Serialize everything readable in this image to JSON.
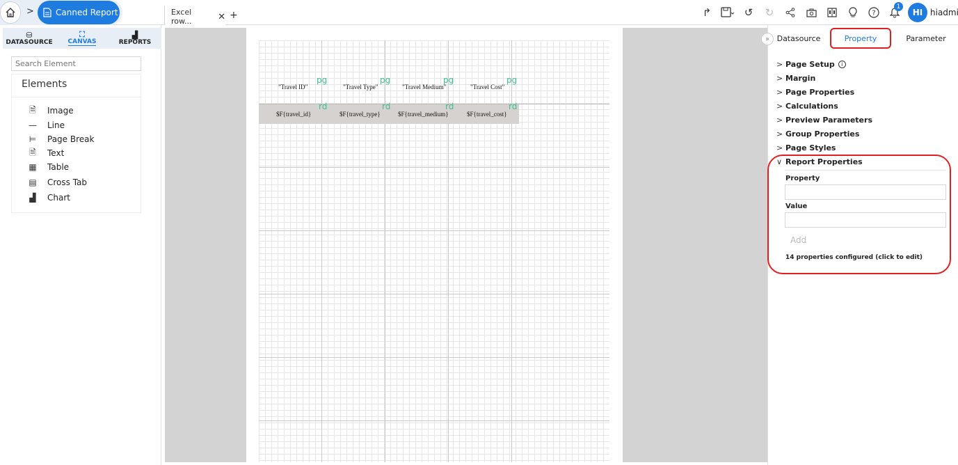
{
  "breadcrumb": {
    "current": "Canned Report"
  },
  "tabs": [
    {
      "label": "Excel row..."
    }
  ],
  "user": {
    "initials": "HI",
    "name": "hiadmin",
    "notifications": "1"
  },
  "left_panel": {
    "tabs": [
      {
        "label": "DATASOURCE",
        "icon": "datasource-icon"
      },
      {
        "label": "CANVAS",
        "icon": "canvas-icon",
        "active": true
      },
      {
        "label": "REPORTS",
        "icon": "reports-icon"
      }
    ],
    "search_placeholder": "Search Element",
    "elements_title": "Elements",
    "elements": [
      {
        "label": "Image",
        "icon": "image-icon"
      },
      {
        "label": "Line",
        "icon": "line-icon"
      },
      {
        "label": "Page Break",
        "icon": "page-break-icon"
      },
      {
        "label": "Text",
        "icon": "text-icon"
      },
      {
        "label": "Table",
        "icon": "table-icon"
      },
      {
        "label": "Cross Tab",
        "icon": "cross-tab-icon"
      },
      {
        "label": "Chart",
        "icon": "chart-icon"
      }
    ]
  },
  "canvas": {
    "headers": [
      "\"Travel ID\"",
      "\"Travel Type\"",
      "\"Travel Medium\"",
      "\"Travel Cost\""
    ],
    "fields": [
      "$F{travel_id}",
      "$F{travel_type}",
      "$F{travel_medium}",
      "$F{travel_cost}"
    ],
    "header_tag": "pg",
    "detail_tag": "rd"
  },
  "right_panel": {
    "tabs": [
      "Datasource",
      "Property",
      "Parameter"
    ],
    "active_tab": "Property",
    "sections": [
      "Page Setup",
      "Margin",
      "Page Properties",
      "Calculations",
      "Preview Parameters",
      "Group Properties",
      "Page Styles"
    ],
    "expanded_section": "Report Properties",
    "property_label": "Property",
    "value_label": "Value",
    "add_label": "Add",
    "configured_text": "14 properties configured (click to edit)"
  },
  "colors": {
    "accent": "#1e7be0",
    "highlight": "#e02020",
    "tag": "#3fbf8f"
  }
}
